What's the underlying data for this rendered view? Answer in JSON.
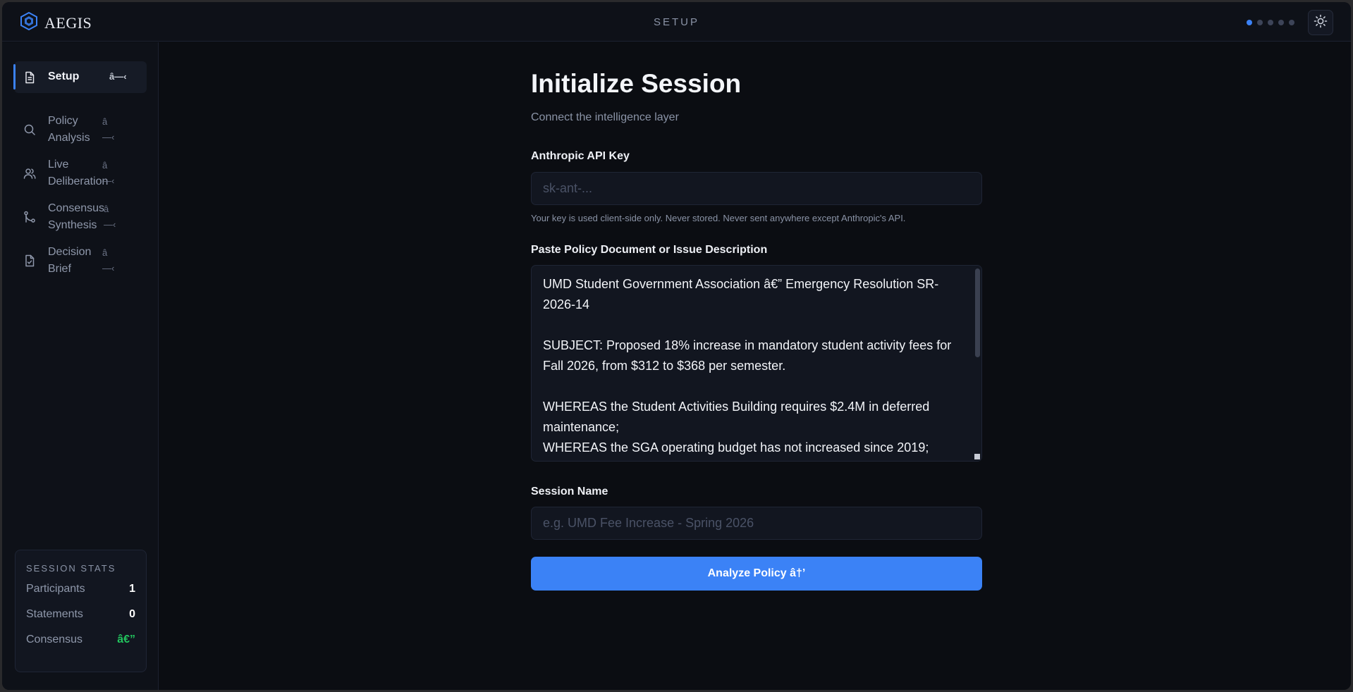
{
  "app": {
    "name": "AEGIS",
    "page_title": "SETUP"
  },
  "progress": {
    "current_step": 1,
    "total_steps": 5
  },
  "colors": {
    "accent": "#3b82f6",
    "background": "#0b0d12",
    "success": "#22c55e"
  },
  "sidebar": {
    "items": [
      {
        "label": "Setup",
        "arrow": "â—‹",
        "icon": "document-icon",
        "active": true
      },
      {
        "label": "Policy Analysis",
        "arrow": "â\n—‹",
        "icon": "search-icon",
        "active": false
      },
      {
        "label": "Live Deliberation",
        "arrow": "â\n—‹",
        "icon": "users-icon",
        "active": false
      },
      {
        "label": "Consensus Synthesis",
        "arrow": "â\n—‹",
        "icon": "git-merge-icon",
        "active": false
      },
      {
        "label": "Decision Brief",
        "arrow": "â\n—‹",
        "icon": "file-check-icon",
        "active": false
      }
    ],
    "stats": {
      "title": "SESSION STATS",
      "rows": [
        {
          "label": "Participants",
          "value": "1"
        },
        {
          "label": "Statements",
          "value": "0"
        },
        {
          "label": "Consensus",
          "value": "â€”"
        }
      ]
    }
  },
  "main": {
    "title": "Initialize Session",
    "subtitle": "Connect the intelligence layer",
    "api_key": {
      "label": "Anthropic API Key",
      "placeholder": "sk-ant-...",
      "value": "",
      "hint": "Your key is used client-side only. Never stored. Never sent anywhere except Anthropic's API."
    },
    "policy": {
      "label": "Paste Policy Document or Issue Description",
      "value": "UMD Student Government Association â€” Emergency Resolution SR-2026-14\n\nSUBJECT: Proposed 18% increase in mandatory student activity fees for Fall 2026, from $312 to $368 per semester.\n\nWHEREAS the Student Activities Building requires $2.4M in deferred maintenance;\nWHEREAS the SGA operating budget has not increased since 2019;"
    },
    "session_name": {
      "label": "Session Name",
      "placeholder": "e.g. UMD Fee Increase - Spring 2026",
      "value": ""
    },
    "submit_label": "Analyze Policy â†’"
  }
}
